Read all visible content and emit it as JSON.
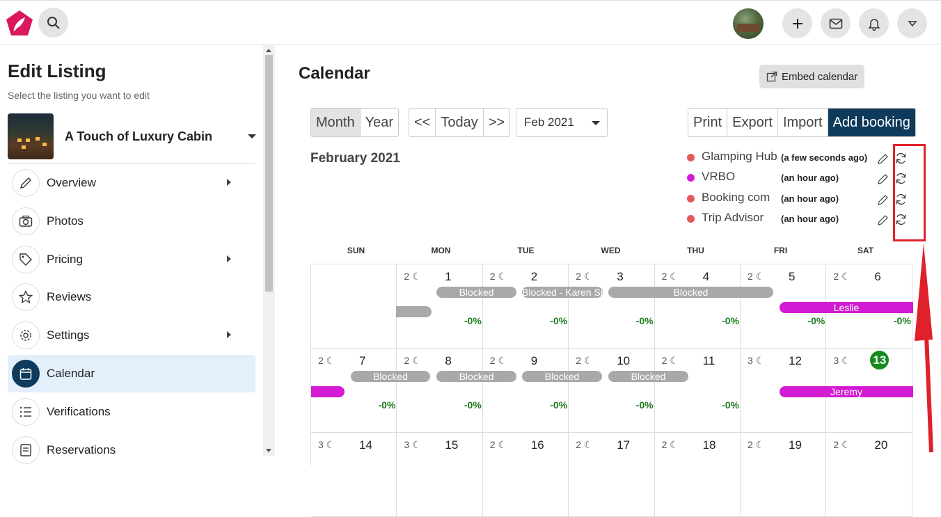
{
  "header": {
    "icons": [
      "logo-icon",
      "search-icon",
      "plus-icon",
      "mail-icon",
      "bell-icon",
      "dropdown-icon"
    ]
  },
  "sidebar": {
    "title": "Edit Listing",
    "subtitle": "Select the listing you want to edit",
    "listing_name": "A Touch of Luxury Cabin",
    "items": [
      {
        "label": "Overview",
        "icon": "pencil-icon",
        "has_submenu": true
      },
      {
        "label": "Photos",
        "icon": "camera-icon",
        "has_submenu": false
      },
      {
        "label": "Pricing",
        "icon": "tag-icon",
        "has_submenu": true
      },
      {
        "label": "Reviews",
        "icon": "star-icon",
        "has_submenu": false
      },
      {
        "label": "Settings",
        "icon": "gear-icon",
        "has_submenu": true
      },
      {
        "label": "Calendar",
        "icon": "calendar-icon",
        "has_submenu": false,
        "active": true
      },
      {
        "label": "Verifications",
        "icon": "list-icon",
        "has_submenu": false
      },
      {
        "label": "Reservations",
        "icon": "reservations-icon",
        "has_submenu": false
      }
    ]
  },
  "calendar": {
    "title": "Calendar",
    "embed_label": "Embed calendar",
    "view_buttons": [
      "Month",
      "Year"
    ],
    "active_view": "Month",
    "nav_buttons": [
      "<<",
      "Today",
      ">>"
    ],
    "month_select": "Feb 2021",
    "action_buttons": [
      "Print",
      "Export",
      "Import",
      "Add booking"
    ],
    "month_heading": "February 2021",
    "syncs": [
      {
        "name": "Glamping Hub",
        "time": "(a few seconds ago)",
        "color": "#e05a5a"
      },
      {
        "name": "VRBO",
        "time": "(an hour ago)",
        "color": "#d21bd2"
      },
      {
        "name": "Booking com",
        "time": "(an hour ago)",
        "color": "#e05a5a"
      },
      {
        "name": "Trip Advisor",
        "time": "(an hour ago)",
        "color": "#e05a5a"
      }
    ],
    "weekdays": [
      "SUN",
      "MON",
      "TUE",
      "WED",
      "THU",
      "FRI",
      "SAT"
    ],
    "weeks": [
      [
        {
          "day": "",
          "minstay": "",
          "pct": ""
        },
        {
          "day": "1",
          "minstay": "2",
          "pct": "-0%"
        },
        {
          "day": "2",
          "minstay": "2",
          "pct": "-0%"
        },
        {
          "day": "3",
          "minstay": "2",
          "pct": "-0%"
        },
        {
          "day": "4",
          "minstay": "2",
          "pct": "-0%"
        },
        {
          "day": "5",
          "minstay": "2",
          "pct": "-0%"
        },
        {
          "day": "6",
          "minstay": "2",
          "pct": "-0%"
        }
      ],
      [
        {
          "day": "7",
          "minstay": "2",
          "pct": "-0%"
        },
        {
          "day": "8",
          "minstay": "2",
          "pct": "-0%"
        },
        {
          "day": "9",
          "minstay": "2",
          "pct": "-0%"
        },
        {
          "day": "10",
          "minstay": "2",
          "pct": "-0%"
        },
        {
          "day": "11",
          "minstay": "2",
          "pct": "-0%"
        },
        {
          "day": "12",
          "minstay": "3",
          "pct": ""
        },
        {
          "day": "13",
          "minstay": "3",
          "pct": "",
          "today": true
        }
      ],
      [
        {
          "day": "14",
          "minstay": "3",
          "pct": ""
        },
        {
          "day": "15",
          "minstay": "3",
          "pct": ""
        },
        {
          "day": "16",
          "minstay": "2",
          "pct": ""
        },
        {
          "day": "17",
          "minstay": "2",
          "pct": ""
        },
        {
          "day": "18",
          "minstay": "2",
          "pct": ""
        },
        {
          "day": "19",
          "minstay": "2",
          "pct": ""
        },
        {
          "day": "20",
          "minstay": "2",
          "pct": ""
        }
      ]
    ],
    "bars": [
      {
        "label": "",
        "style": "gray"
      },
      {
        "label": "Blocked",
        "style": "gray"
      },
      {
        "label": "Blocked - Karen Smith",
        "style": "gray"
      },
      {
        "label": "Blocked",
        "style": "gray"
      },
      {
        "label": "Leslie",
        "style": "mag"
      },
      {
        "label": "",
        "style": "mag"
      },
      {
        "label": "Blocked",
        "style": "gray"
      },
      {
        "label": "Blocked",
        "style": "gray"
      },
      {
        "label": "Blocked",
        "style": "gray"
      },
      {
        "label": "Blocked",
        "style": "gray"
      },
      {
        "label": "Jeremy",
        "style": "mag"
      }
    ]
  }
}
